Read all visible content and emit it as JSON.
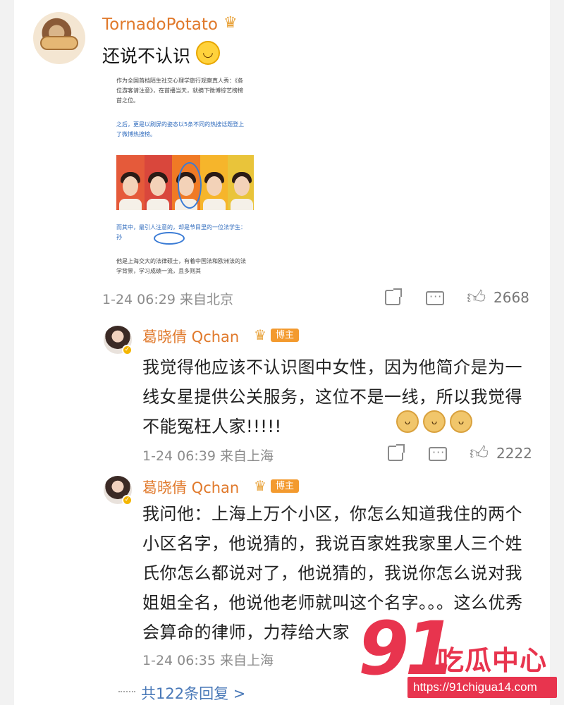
{
  "post": {
    "username": "TornadoPotato",
    "text": "还说不认识",
    "emoji": "😂",
    "embedded_image": {
      "para1": "作为全国首档陌生社交心理学旅行观察真人秀：《各位游客请注意》，在首播当天，就摘下微博综艺榜榜首之位。",
      "para2": "之后，更是以刷屏的姿态以5条不同的热搜话题登上了微博热搜榜。",
      "para3": "而其中，最引人注意的，却是节目里的一位法学生：孙",
      "para4": "他是上海交大的法律硕士，有着中国法和欧洲法的法学背景，学习成绩一流，且多则其"
    },
    "time": "1-24 06:29",
    "location": "来自北京",
    "likes": "2668"
  },
  "replies": [
    {
      "name": "葛晓倩 Qchan",
      "badge": "博主",
      "text": "我觉得他应该不认识图中女性，因为他简介是为一线女星提供公关服务，这位不是一线，所以我觉得不能冤枉人家!!!!!",
      "time": "1-24 06:39",
      "location": "来自上海",
      "likes": "2222"
    },
    {
      "name": "葛晓倩 Qchan",
      "badge": "博主",
      "text": "我问他：上海上万个小区，你怎么知道我住的两个小区名字，他说猜的，我说百家姓我家里人三个姓氏你怎么都说对了，他说猜的，我说你怎么说对我姐姐全名，他说他老师就叫这个名字。。。这么优秀会算命的律师，力荐给大家",
      "time": "1-24 06:35",
      "location": "来自上海"
    }
  ],
  "more_replies": "共122条回复 >",
  "watermark": {
    "number": "91",
    "name": "吃瓜中心",
    "url": "https://91chigua14.com"
  },
  "icons": [
    "crown-icon",
    "laugh-icon",
    "share-icon",
    "comment-icon",
    "like-icon",
    "verified-icon",
    "doge-icon"
  ],
  "colors": {
    "username": "#e0792b",
    "link": "#4a79b8",
    "meta": "#8c8c8c",
    "watermark": "#e8344e"
  }
}
